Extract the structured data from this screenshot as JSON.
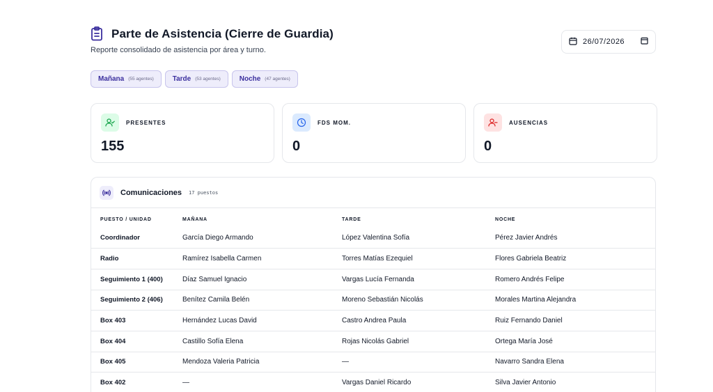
{
  "header": {
    "title": "Parte de Asistencia (Cierre de Guardia)",
    "subtitle": "Reporte consolidado de asistencia por área y turno.",
    "icon": "clipboard-icon"
  },
  "date": {
    "value": "26/07/2026"
  },
  "shifts": [
    {
      "label": "Mañana",
      "count": "(55 agentes)"
    },
    {
      "label": "Tarde",
      "count": "(53 agentes)"
    },
    {
      "label": "Noche",
      "count": "(47 agentes)"
    }
  ],
  "stats": [
    {
      "label": "PRESENTES",
      "value": "155",
      "icon": "user-check-icon",
      "color": "#16a34a",
      "bg": "#dcfce7"
    },
    {
      "label": "FDS MOM.",
      "value": "0",
      "icon": "clock-icon",
      "color": "#2563eb",
      "bg": "#dbeafe"
    },
    {
      "label": "AUSENCIAS",
      "value": "0",
      "icon": "user-minus-icon",
      "color": "#dc2626",
      "bg": "#fee2e2"
    }
  ],
  "panel": {
    "title": "Comunicaciones",
    "count": "17 puestos",
    "icon": "radio-icon",
    "columns": [
      "PUESTO / UNIDAD",
      "MAÑANA",
      "TARDE",
      "NOCHE"
    ],
    "rows": [
      [
        "Coordinador",
        "García Diego Armando",
        "López Valentina Sofía",
        "Pérez Javier Andrés"
      ],
      [
        "Radio",
        "Ramírez Isabella Carmen",
        "Torres Matías Ezequiel",
        "Flores Gabriela Beatriz"
      ],
      [
        "Seguimiento 1 (400)",
        "Díaz Samuel Ignacio",
        "Vargas Lucía Fernanda",
        "Romero Andrés Felipe"
      ],
      [
        "Seguimiento 2 (406)",
        "Benítez Camila Belén",
        "Moreno Sebastián Nicolás",
        "Morales Martina Alejandra"
      ],
      [
        "Box 403",
        "Hernández Lucas David",
        "Castro Andrea Paula",
        "Ruiz Fernando Daniel"
      ],
      [
        "Box 404",
        "Castillo Sofía Elena",
        "Rojas Nicolás Gabriel",
        "Ortega María José"
      ],
      [
        "Box 405",
        "Mendoza Valeria Patricia",
        "—",
        "Navarro Sandra Elena"
      ],
      [
        "Box 402",
        "—",
        "Vargas Daniel Ricardo",
        "Silva Javier Antonio"
      ]
    ]
  }
}
